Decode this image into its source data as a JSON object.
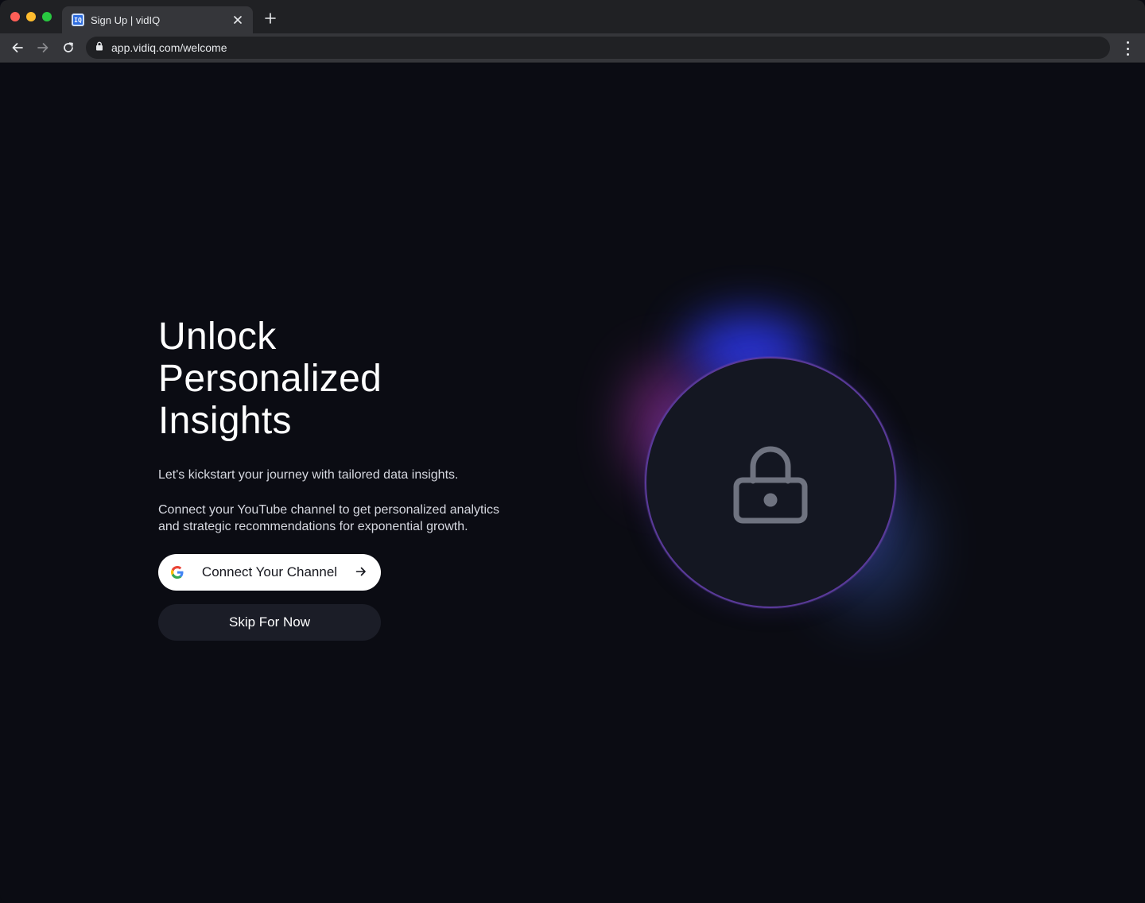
{
  "browser": {
    "tab_title": "Sign Up | vidIQ",
    "favicon_text": "IQ",
    "url": "app.vidiq.com/welcome"
  },
  "main": {
    "headline_line1": "Unlock",
    "headline_line2": "Personalized",
    "headline_line3": "Insights",
    "intro": "Let's kickstart your journey with tailored data insights.",
    "description": "Connect your YouTube channel to get personalized analytics and strategic recommendations for exponential growth.",
    "connect_button": "Connect Your Channel",
    "skip_button": "Skip For Now"
  },
  "icons": {
    "provider": "google-icon",
    "arrow": "arrow-right-icon",
    "illustration": "lock-icon"
  },
  "colors": {
    "background": "#0b0c13",
    "primary_button": "#ffffff",
    "secondary_button": "#1b1d27",
    "orb_ring": "#5a3a9a",
    "glow_blue": "#2f3bff",
    "glow_magenta": "#c23ccc"
  }
}
